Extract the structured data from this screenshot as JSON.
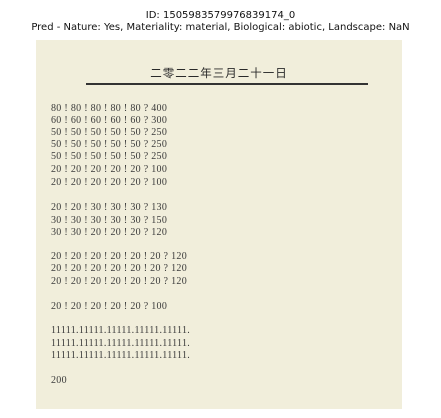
{
  "caption": {
    "id_line": "ID: 1505983579976839174_0",
    "pred_line": "Pred - Nature: Yes, Materiality: material, Biological: abiotic, Landscape: NaN"
  },
  "document": {
    "title": "二零二二年三月二十一日",
    "lines": [
      "80 ! 80 ! 80 ! 80 ! 80 ? 400",
      "60 ! 60 ! 60 ! 60 ! 60 ? 300",
      "50 ! 50 ! 50 ! 50 ! 50 ? 250",
      "50 ! 50 ! 50 ! 50 ! 50 ? 250",
      "50 ! 50 ! 50 ! 50 ! 50 ? 250",
      "20 ! 20 ! 20 ! 20 ! 20 ? 100",
      "20 ! 20 ! 20 ! 20 ! 20 ? 100",
      "20 ! 20 ! 30 ! 30 ! 30 ? 130",
      "30 ! 30 ! 30 ! 30 ! 30 ? 150",
      "30 ! 30 ! 20 ! 20 ! 20 ? 120",
      "20 ! 20 ! 20 ! 20 ! 20 ! 20 ? 120",
      "20 ! 20 ! 20 ! 20 ! 20 ! 20 ? 120",
      "20 ! 20 ! 20 ! 20 ! 20 ! 20 ? 120",
      "20 ! 20 ! 20 ! 20 ! 20 ? 100",
      "11111.11111.11111.11111.11111.",
      "11111.11111.11111.11111.11111.",
      "11111.11111.11111.11111.11111.",
      "200"
    ]
  }
}
